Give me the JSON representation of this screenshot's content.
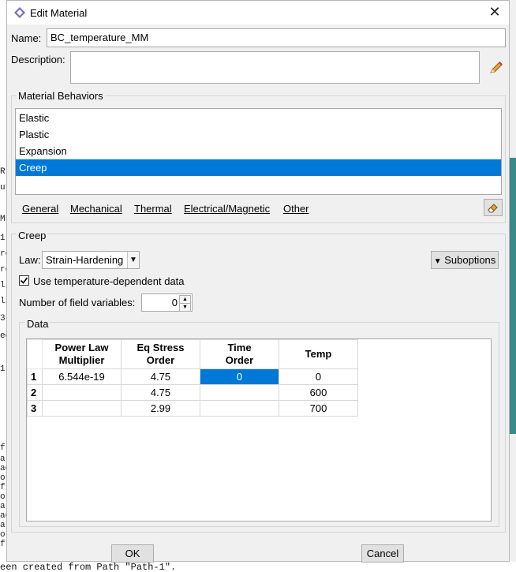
{
  "window": {
    "title": "Edit Material"
  },
  "name_label": "Name:",
  "name_value": "BC_temperature_MM",
  "description_label": "Description:",
  "description_value": "",
  "behaviors": {
    "title": "Material Behaviors",
    "items": [
      "Elastic",
      "Plastic",
      "Expansion",
      "Creep"
    ],
    "selected": "Creep"
  },
  "menu": {
    "general": "General",
    "mechanical": "Mechanical",
    "thermal": "Thermal",
    "electrical": "Electrical/Magnetic",
    "other": "Other"
  },
  "creep": {
    "title": "Creep",
    "law_label": "Law:",
    "law_value": "Strain-Hardening",
    "suboptions_label": "Suboptions",
    "temp_dep_label": "Use temperature-dependent data",
    "temp_dep_checked": true,
    "field_vars_label": "Number of field variables:",
    "field_vars_value": "0"
  },
  "data": {
    "title": "Data",
    "headers": [
      "Power Law\nMultiplier",
      "Eq Stress\nOrder",
      "Time\nOrder",
      "Temp"
    ],
    "rows": [
      {
        "num": "1",
        "cells": [
          "6.544e-19",
          "4.75",
          "0",
          "0"
        ]
      },
      {
        "num": "2",
        "cells": [
          "",
          "4.75",
          "",
          "600"
        ]
      },
      {
        "num": "3",
        "cells": [
          "",
          "2.99",
          "",
          "700"
        ]
      }
    ]
  },
  "buttons": {
    "ok": "OK",
    "cancel": "Cancel"
  },
  "background": {
    "bottom_text": "een created from Path \"Path-1\".",
    "left_fragments": [
      "R",
      "ut",
      "M",
      "1",
      "ro",
      "ro",
      "li",
      "li",
      "3)",
      "ec",
      "1)",
      "f",
      "al",
      "ac",
      "ol",
      "f",
      "ol",
      "al",
      "ac",
      "al",
      "ol",
      "f"
    ]
  },
  "colors": {
    "selection": "#0078d7",
    "dialog_bg": "#f0f0f0"
  }
}
